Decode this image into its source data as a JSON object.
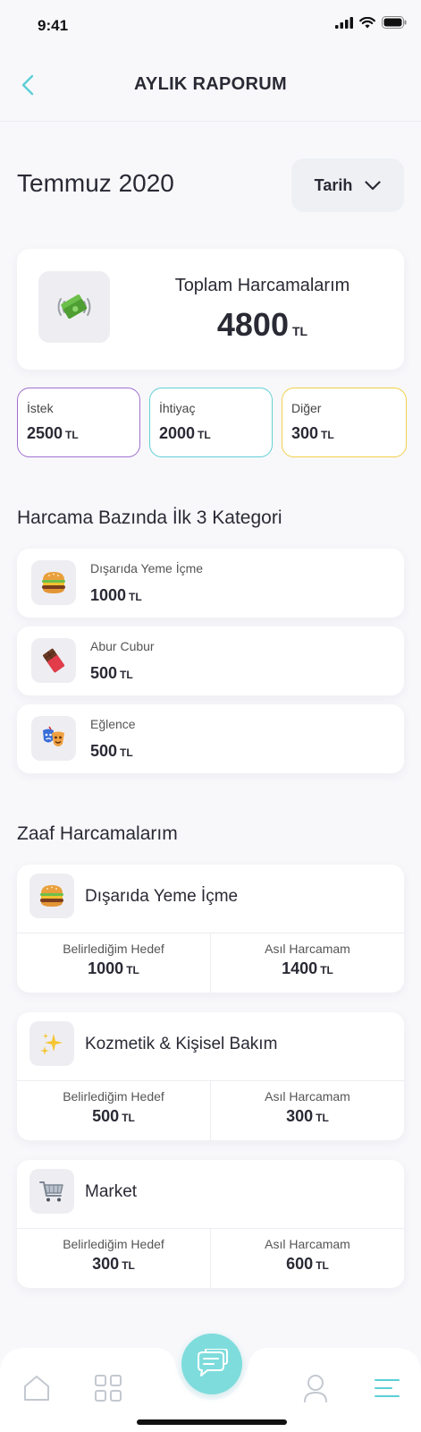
{
  "status_bar": {
    "time": "9:41"
  },
  "header": {
    "title": "AYLIK RAPORUM"
  },
  "period": {
    "title": "Temmuz 2020",
    "date_button_label": "Tarih"
  },
  "total": {
    "label": "Toplam Harcamalarım",
    "value": "4800",
    "unit": "TL",
    "icon": "money-icon"
  },
  "splits": [
    {
      "label": "İstek",
      "value": "2500",
      "unit": "TL",
      "color": "#a070d0"
    },
    {
      "label": "İhtiyaç",
      "value": "2000",
      "unit": "TL",
      "color": "#62d0d6"
    },
    {
      "label": "Diğer",
      "value": "300",
      "unit": "TL",
      "color": "#f2d04a"
    }
  ],
  "top_categories": {
    "title": "Harcama Bazında İlk 3 Kategori",
    "items": [
      {
        "label": "Dışarıda Yeme İçme",
        "value": "1000",
        "unit": "TL",
        "icon": "burger-icon"
      },
      {
        "label": "Abur Cubur",
        "value": "500",
        "unit": "TL",
        "icon": "chocolate-icon"
      },
      {
        "label": "Eğlence",
        "value": "500",
        "unit": "TL",
        "icon": "theater-masks-icon"
      }
    ]
  },
  "weak_spending": {
    "title": "Zaaf Harcamalarım",
    "items": [
      {
        "title": "Dışarıda Yeme İçme",
        "icon": "burger-icon",
        "target_label": "Belirlediğim Hedef",
        "target_value": "1000",
        "actual_label": "Asıl Harcamam",
        "actual_value": "1400",
        "unit": "TL"
      },
      {
        "title": "Kozmetik & Kişisel Bakım",
        "icon": "sparkles-icon",
        "target_label": "Belirlediğim Hedef",
        "target_value": "500",
        "actual_label": "Asıl Harcamam",
        "actual_value": "300",
        "unit": "TL"
      },
      {
        "title": "Market",
        "icon": "shopping-cart-icon",
        "target_label": "Belirlediğim Hedef",
        "target_value": "300",
        "actual_label": "Asıl Harcamam",
        "actual_value": "600",
        "unit": "TL"
      }
    ]
  },
  "tab_bar": {
    "items": [
      "home-icon",
      "grid-icon",
      "chat-icon",
      "profile-icon",
      "menu-icon"
    ],
    "active": "menu-icon",
    "accent_color": "#5ccfd6",
    "fab_color": "#7fdcdc"
  }
}
